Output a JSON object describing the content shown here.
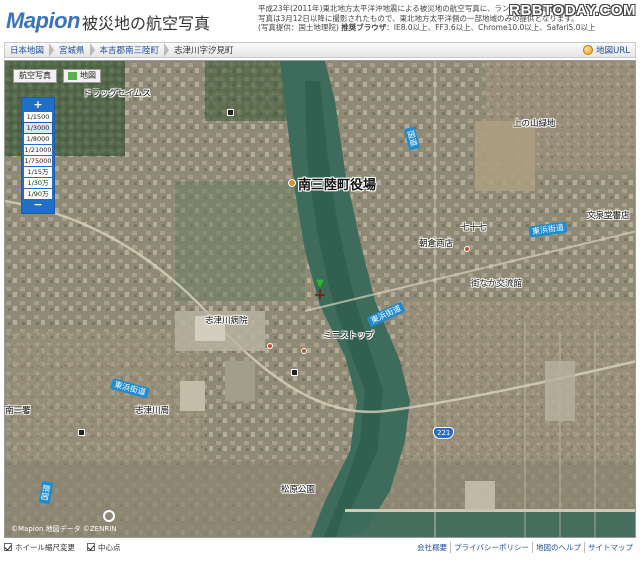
{
  "header": {
    "logo_text": "Mapion",
    "title": "被災地の航空写真",
    "notice_line1": "平成23年(2011年)東北地方太平洋沖地震による被災地の航空写真に、ランドマーク情報を重ね",
    "notice_line2": "写真は3月12日以降に撮影されたもので、東北地方太平洋側の一部地域のみの提供となります。",
    "notice_line3": "(写真提供：国土地理院)",
    "browser_label": "推奨ブラウザ",
    "browser_text": "：IE8.0以上、FF3.6以上、Chrome10.0以上、Safari5.0以上",
    "watermark": "RBBTODAY.COM"
  },
  "breadcrumb": {
    "items": [
      "日本地図",
      "宮城県",
      "本吉郡南三陸町",
      "志津川字汐見町"
    ],
    "map_url_label": "地図URL"
  },
  "map": {
    "view_tabs": {
      "photo": "航空写真",
      "map": "地図"
    },
    "zoom": {
      "plus": "+",
      "minus": "−",
      "levels": [
        "1/1500",
        "1/3000",
        "1/8000",
        "1/21000",
        "1/75000",
        "1/15万",
        "1/30万",
        "1/90万"
      ],
      "selected": "1/3000"
    },
    "labels": {
      "town_office": "南三陸町役場",
      "drugstore": "ドラッグセイムス",
      "hospital": "志津川病院",
      "high_school": "志津川局",
      "police": "南三署",
      "mini_stop": "ミニストップ",
      "asahiya": "朝倉商店",
      "machinaka": "街なか交流館",
      "kamenoyama": "上の山緑地",
      "nanamagari": "七十七",
      "bunsen": "文泉堂書店",
      "matsubara": "松原公園"
    },
    "roads": {
      "tohama_east": "東浜街道",
      "tohama_center": "東浜街道",
      "tohama_west": "東浜街道",
      "route_north": "国道",
      "route_south": "国道",
      "r221": "221"
    },
    "copyright": "©Mapion  地図データ ©ZENRIN"
  },
  "footer": {
    "wheel_option": "ホイール縮尺変更",
    "center_option": "中心点",
    "links": [
      "会社概要",
      "プライバシーポリシー",
      "地図のヘルプ",
      "サイトマップ"
    ]
  }
}
